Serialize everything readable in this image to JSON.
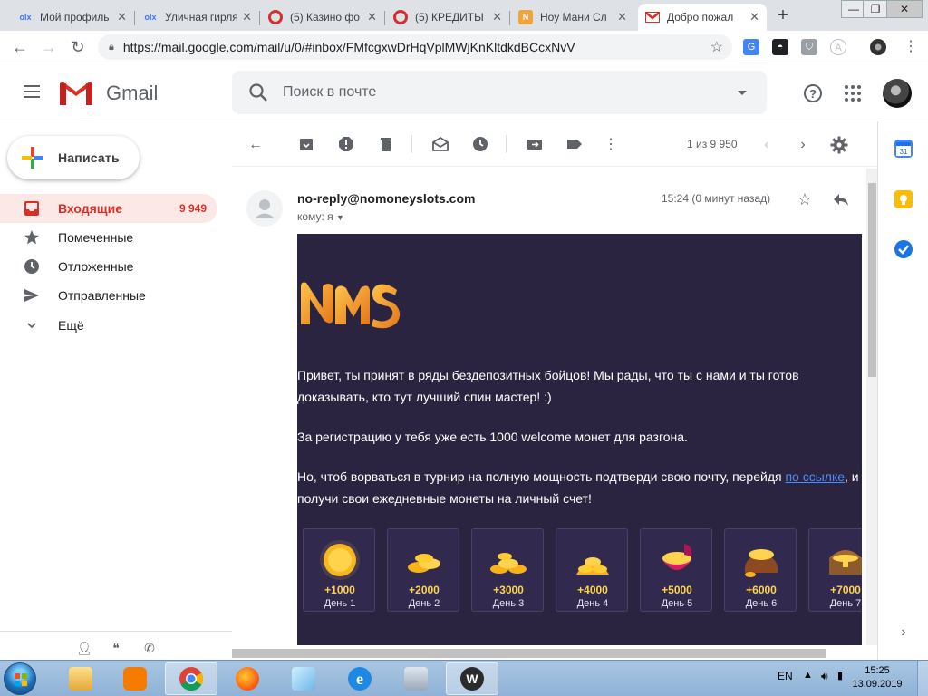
{
  "browser": {
    "tabs": [
      {
        "title": "Мой профиль",
        "favicon": "olx-icon",
        "active": false
      },
      {
        "title": "Уличная гирлянда",
        "favicon": "olx-icon",
        "active": false
      },
      {
        "title": "(5) Казино фо",
        "favicon": "opera-icon",
        "active": false
      },
      {
        "title": "(5) КРЕДИТЫ",
        "favicon": "opera-icon",
        "active": false
      },
      {
        "title": "Ноу Мани Сл",
        "favicon": "nms-icon",
        "active": false
      },
      {
        "title": "Добро пожал",
        "favicon": "gmail-icon",
        "active": true
      }
    ],
    "url": "https://mail.google.com/mail/u/0/#inbox/FMfcgxwDrHqVplMWjKnKltdkdBCcxNvV"
  },
  "gmail": {
    "brand": "Gmail",
    "search_placeholder": "Поиск в почте",
    "compose_label": "Написать",
    "nav": [
      {
        "label": "Входящие",
        "count": "9 949",
        "icon": "inbox-icon",
        "active": true
      },
      {
        "label": "Помеченные",
        "count": "",
        "icon": "star-icon",
        "active": false
      },
      {
        "label": "Отложенные",
        "count": "",
        "icon": "clock-icon",
        "active": false
      },
      {
        "label": "Отправленные",
        "count": "",
        "icon": "send-icon",
        "active": false
      },
      {
        "label": "Ещё",
        "count": "",
        "icon": "chevron-down-icon",
        "active": false
      }
    ],
    "pager": "1 из 9 950",
    "message": {
      "sender": "no-reply@nomoneyslots.com",
      "to": "кому: я",
      "time": "15:24 (0 минут назад)"
    },
    "email": {
      "p1_line1": "Привет, ты принят в ряды бездепозитных бойцов! Мы рады, что ты с нами и ты готов",
      "p1_line2": "доказывать, кто тут лучший спин мастер! :)",
      "p2": "За регистрацию у тебя уже есть 1000 welcome монет для разгона.",
      "p3_line1_before": "Но, чтоб ворваться в турнир на полную мощность подтверди свою почту, перейдя ",
      "p3_link": "по ссылке",
      "p3_line1_after": ", и",
      "p3_line2": "получи свои ежедневные монеты на личный счет!",
      "rewards": [
        {
          "amount": "+1000",
          "day": "День 1"
        },
        {
          "amount": "+2000",
          "day": "День 2"
        },
        {
          "amount": "+3000",
          "day": "День 3"
        },
        {
          "amount": "+4000",
          "day": "День 4"
        },
        {
          "amount": "+5000",
          "day": "День 5"
        },
        {
          "amount": "+6000",
          "day": "День 6"
        },
        {
          "amount": "+7000",
          "day": "День 7"
        }
      ]
    }
  },
  "taskbar": {
    "lang": "EN",
    "time": "15:25",
    "date": "13.09.2019"
  },
  "colors": {
    "gmail_red": "#d93025",
    "email_bg": "#2b2440",
    "coin_gold": "#ffd34d",
    "link": "#4c8cff"
  }
}
